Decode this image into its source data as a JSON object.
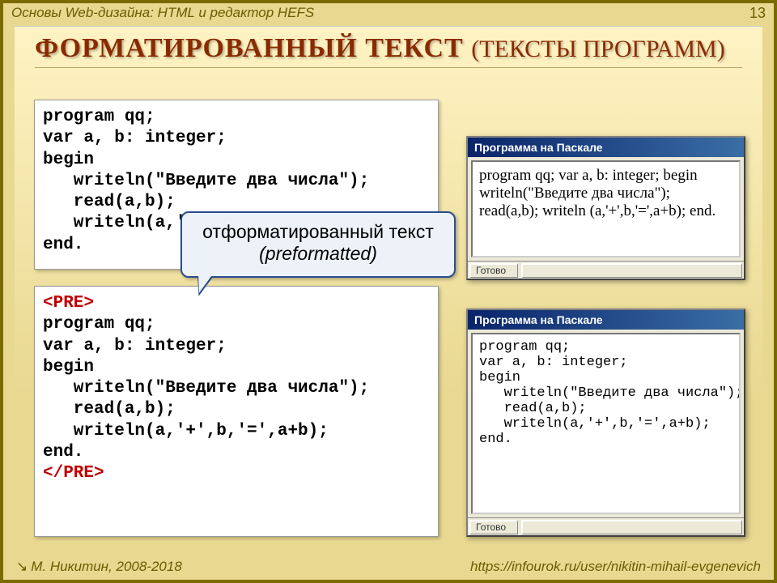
{
  "header": {
    "breadcrumb": "Основы Web-дизайна: HTML и редактор HEFS",
    "page_number": "13"
  },
  "title": {
    "main": "ФОРМАТИРОВАННЫЙ ТЕКСТ",
    "sub": "(ТЕКСТЫ ПРОГРАММ)"
  },
  "codebox1": {
    "text": "program qq;\nvar a, b: integer;\nbegin\n   writeln(\"Введите два числа\");\n   read(a,b);\n   writeln(a,'+',b,'=',a+b);\nend."
  },
  "codebox2": {
    "open_tag": "<PRE>",
    "text": "program qq;\nvar a, b: integer;\nbegin\n   writeln(\"Введите два числа\");\n   read(a,b);\n   writeln(a,'+',b,'=',a+b);\nend.",
    "close_tag": "</PRE>"
  },
  "callout": {
    "line1": "отформатированный текст",
    "line2": "(preformatted)"
  },
  "window1": {
    "title": "Программа на Паскале",
    "body": "program qq; var a, b: integer; begin writeln(\"Введите два числа\"); read(a,b); writeln (a,'+',b,'=',a+b); end.",
    "status": "Готово"
  },
  "window2": {
    "title": "Программа на Паскале",
    "body": "program qq;\nvar a, b: integer;\nbegin\n   writeln(\"Введите два числа\");\n   read(a,b);\n   writeln(a,'+',b,'=',a+b);\nend.",
    "status": "Готово"
  },
  "footer": {
    "author": "М. Никитин, 2008-2018",
    "url": "https://infourok.ru/user/nikitin-mihail-evgenevich"
  }
}
